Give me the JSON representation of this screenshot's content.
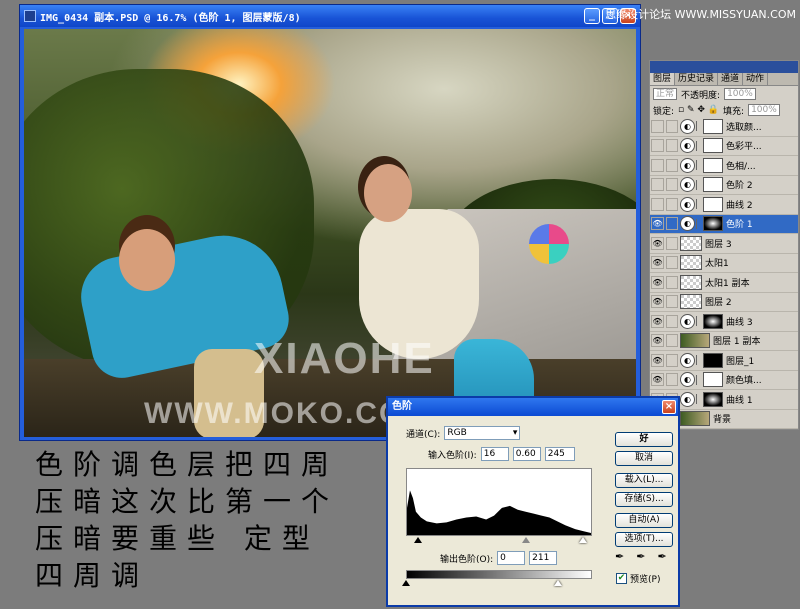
{
  "window": {
    "title": "IMG_0434 副本.PSD @ 16.7% (色阶 1, 图层蒙版/8)",
    "min": "_",
    "max": "□",
    "close": "×"
  },
  "site_watermark": "思缘设计论坛 WWW.MISSYUAN.COM",
  "photo_watermark": {
    "line1": "XIAOHE",
    "line2": "WWW.MOKO.CC/XUNUO"
  },
  "layers_panel": {
    "tabs": [
      "图层",
      "历史记录",
      "通道",
      "动作"
    ],
    "blend_mode": "正常",
    "opacity_label": "不透明度:",
    "opacity_value": "100%",
    "lock_label": "锁定:",
    "fill_label": "填充:",
    "fill_value": "100%",
    "layers": [
      {
        "name": "选取颜...",
        "type": "adj",
        "mask": "white",
        "visible": false
      },
      {
        "name": "色彩平...",
        "type": "adj",
        "mask": "white",
        "visible": false
      },
      {
        "name": "色相/...",
        "type": "adj",
        "mask": "white",
        "visible": false
      },
      {
        "name": "色阶 2",
        "type": "adj",
        "mask": "white",
        "visible": false
      },
      {
        "name": "曲线 2",
        "type": "adj",
        "mask": "white",
        "visible": false
      },
      {
        "name": "色阶 1",
        "type": "adj",
        "mask": "dark",
        "visible": true,
        "active": true
      },
      {
        "name": "图层 3",
        "type": "pix",
        "visible": true
      },
      {
        "name": "太阳1",
        "type": "pix",
        "visible": true
      },
      {
        "name": "太阳1 副本",
        "type": "pix",
        "visible": true
      },
      {
        "name": "图层 2",
        "type": "pix",
        "visible": true
      },
      {
        "name": "曲线 3",
        "type": "adj",
        "mask": "dark",
        "visible": true
      },
      {
        "name": "图层 1 副本",
        "type": "photo",
        "visible": true
      },
      {
        "name": "图层_1",
        "type": "adj",
        "mask": "black",
        "visible": true
      },
      {
        "name": "颜色填...",
        "type": "adj",
        "mask": "white",
        "visible": true
      },
      {
        "name": "曲线 1",
        "type": "adj",
        "mask": "dark",
        "visible": true
      },
      {
        "name": "背景",
        "type": "photo",
        "visible": true
      }
    ]
  },
  "levels_dialog": {
    "title": "色阶",
    "channel_label": "通道(C):",
    "channel_value": "RGB",
    "input_label": "输入色阶(I):",
    "input_black": "16",
    "input_gamma": "0.60",
    "input_white": "245",
    "output_label": "输出色阶(O):",
    "output_black": "0",
    "output_white": "211",
    "buttons": [
      "好",
      "取消",
      "载入(L)...",
      "存储(S)...",
      "自动(A)",
      "选项(T)..."
    ],
    "preview_label": "预览(P)",
    "preview_checked": true
  },
  "caption": {
    "lines": [
      "色阶调色层把四周",
      "压暗这次比第一个",
      "压暗要重些  定型",
      "四周调"
    ]
  }
}
